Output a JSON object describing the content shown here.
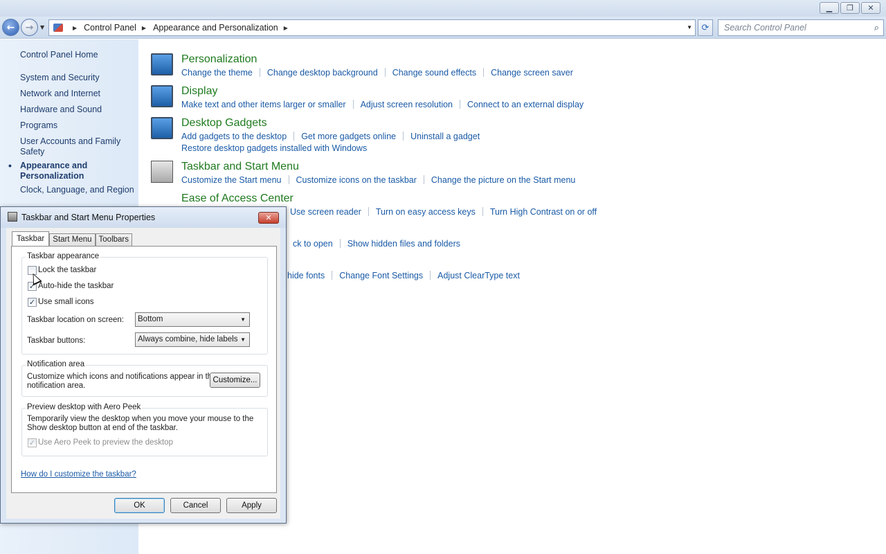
{
  "window": {
    "minimize_icon": "minimize-icon",
    "maximize_icon": "restore-icon",
    "close_icon": "close-icon"
  },
  "address": {
    "crumbs": [
      "Control Panel",
      "Appearance and Personalization"
    ],
    "search_placeholder": "Search Control Panel"
  },
  "sidebar": {
    "items": [
      {
        "label": "Control Panel Home"
      },
      {
        "label": "System and Security"
      },
      {
        "label": "Network and Internet"
      },
      {
        "label": "Hardware and Sound"
      },
      {
        "label": "Programs"
      },
      {
        "label": "User Accounts and Family Safety"
      },
      {
        "label": "Appearance and Personalization",
        "current": true
      },
      {
        "label": "Clock, Language, and Region"
      }
    ]
  },
  "categories": [
    {
      "title": "Personalization",
      "links": [
        "Change the theme",
        "Change desktop background",
        "Change sound effects",
        "Change screen saver"
      ]
    },
    {
      "title": "Display",
      "links": [
        "Make text and other items larger or smaller",
        "Adjust screen resolution",
        "Connect to an external display"
      ]
    },
    {
      "title": "Desktop Gadgets",
      "links": [
        "Add gadgets to the desktop",
        "Get more gadgets online",
        "Uninstall a gadget"
      ],
      "links2": [
        "Restore desktop gadgets installed with Windows"
      ]
    },
    {
      "title": "Taskbar and Start Menu",
      "links": [
        "Customize the Start menu",
        "Customize icons on the taskbar",
        "Change the picture on the Start menu"
      ]
    },
    {
      "title": "Ease of Access Center",
      "links": [
        "Use screen reader",
        "Turn on easy access keys",
        "Turn High Contrast on or off"
      ]
    },
    {
      "title": "",
      "links": [
        "ck to open",
        "Show hidden files and folders"
      ]
    },
    {
      "title": "",
      "links": [
        "hide fonts",
        "Change Font Settings",
        "Adjust ClearType text"
      ]
    }
  ],
  "dialog": {
    "title": "Taskbar and Start Menu Properties",
    "tabs": [
      "Taskbar",
      "Start Menu",
      "Toolbars"
    ],
    "appearance_group": "Taskbar appearance",
    "lock_label": "Lock the taskbar",
    "lock_checked": false,
    "autohide_label": "Auto-hide the taskbar",
    "autohide_checked": true,
    "small_icons_label": "Use small icons",
    "small_icons_checked": true,
    "location_label": "Taskbar location on screen:",
    "location_value": "Bottom",
    "buttons_label": "Taskbar buttons:",
    "buttons_value": "Always combine, hide labels",
    "notification_group": "Notification area",
    "notification_text_1": "Customize which icons and notifications appear in the",
    "notification_text_2": "notification area.",
    "customize_label": "Customize...",
    "peek_group": "Preview desktop with Aero Peek",
    "peek_text_1": "Temporarily view the desktop when you move your mouse to the",
    "peek_text_2": "Show desktop button at end of the taskbar.",
    "peek_checkbox_label": "Use Aero Peek to preview the desktop",
    "peek_checked": true,
    "help_link": "How do I customize the taskbar?",
    "ok_label": "OK",
    "cancel_label": "Cancel",
    "apply_label": "Apply"
  }
}
